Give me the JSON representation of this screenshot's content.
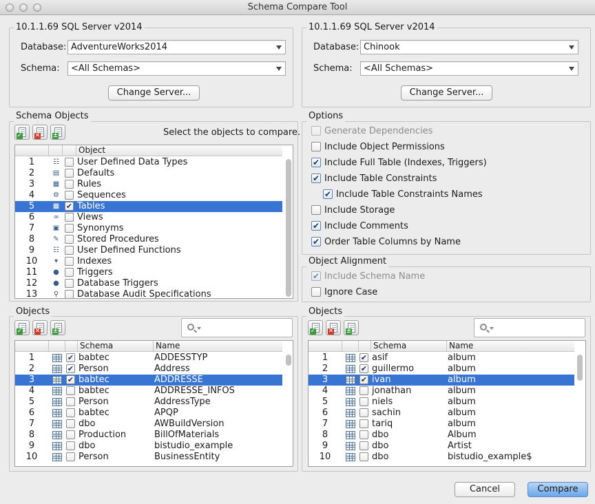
{
  "window": {
    "title": "Schema Compare Tool"
  },
  "left_server": {
    "title": "10.1.1.69 SQL Server v2014",
    "database_label": "Database:",
    "database_value": "AdventureWorks2014",
    "schema_label": "Schema:",
    "schema_value": "<All Schemas>",
    "change_button": "Change Server..."
  },
  "right_server": {
    "title": "10.1.1.69 SQL Server v2014",
    "database_label": "Database:",
    "database_value": "Chinook",
    "schema_label": "Schema:",
    "schema_value": "<All Schemas>",
    "change_button": "Change Server..."
  },
  "schema_objects": {
    "title": "Schema Objects",
    "hint": "Select the objects to compare.",
    "column_object": "Object",
    "rows": [
      {
        "n": "1",
        "label": "User Defined Data Types",
        "checked": false,
        "selected": false,
        "icon": "udt-icon",
        "glyph": "☷"
      },
      {
        "n": "2",
        "label": "Defaults",
        "checked": false,
        "selected": false,
        "icon": "defaults-icon",
        "glyph": "▤"
      },
      {
        "n": "3",
        "label": "Rules",
        "checked": false,
        "selected": false,
        "icon": "rules-icon",
        "glyph": "▦"
      },
      {
        "n": "4",
        "label": "Sequences",
        "checked": false,
        "selected": false,
        "icon": "sequences-icon",
        "glyph": "⚙"
      },
      {
        "n": "5",
        "label": "Tables",
        "checked": true,
        "selected": true,
        "icon": "tables-icon",
        "glyph": "▦"
      },
      {
        "n": "6",
        "label": "Views",
        "checked": false,
        "selected": false,
        "icon": "views-icon",
        "glyph": "∞"
      },
      {
        "n": "7",
        "label": "Synonyms",
        "checked": false,
        "selected": false,
        "icon": "synonyms-icon",
        "glyph": "▣"
      },
      {
        "n": "8",
        "label": "Stored Procedures",
        "checked": false,
        "selected": false,
        "icon": "stored-procedures-icon",
        "glyph": "✎"
      },
      {
        "n": "9",
        "label": "User Defined Functions",
        "checked": false,
        "selected": false,
        "icon": "udf-icon",
        "glyph": "☷"
      },
      {
        "n": "10",
        "label": "Indexes",
        "checked": false,
        "selected": false,
        "icon": "indexes-icon",
        "glyph": "▾"
      },
      {
        "n": "11",
        "label": "Triggers",
        "checked": false,
        "selected": false,
        "icon": "triggers-icon",
        "glyph": "●"
      },
      {
        "n": "12",
        "label": "Database Triggers",
        "checked": false,
        "selected": false,
        "icon": "database-triggers-icon",
        "glyph": "●"
      },
      {
        "n": "13",
        "label": "Database Audit Specifications",
        "checked": false,
        "selected": false,
        "icon": "audit-icon",
        "glyph": "⚲"
      }
    ]
  },
  "options": {
    "title": "Options",
    "items": [
      {
        "label": "Generate Dependencies",
        "checked": false,
        "disabled": true
      },
      {
        "label": "Include Object Permissions",
        "checked": false,
        "disabled": false
      },
      {
        "label": "Include Full Table (Indexes, Triggers)",
        "checked": true,
        "disabled": false
      },
      {
        "label": "Include Table Constraints",
        "checked": true,
        "disabled": false
      },
      {
        "label": "Include Table Constraints Names",
        "checked": true,
        "disabled": false
      },
      {
        "label": "Include Storage",
        "checked": false,
        "disabled": false
      },
      {
        "label": "Include Comments",
        "checked": true,
        "disabled": false
      },
      {
        "label": "Order Table Columns by Name",
        "checked": true,
        "disabled": false
      }
    ]
  },
  "alignment": {
    "title": "Object Alignment",
    "items": [
      {
        "label": "Include Schema Name",
        "checked": true,
        "disabled": true
      },
      {
        "label": "Ignore Case",
        "checked": false,
        "disabled": false
      }
    ]
  },
  "left_objects": {
    "title": "Objects",
    "search_placeholder": "",
    "col_schema": "Schema",
    "col_name": "Name",
    "rows": [
      {
        "n": "1",
        "schema": "babtec",
        "name": "ADDESSTYP",
        "checked": true,
        "selected": false
      },
      {
        "n": "2",
        "schema": "Person",
        "name": "Address",
        "checked": true,
        "selected": false
      },
      {
        "n": "3",
        "schema": "babtec",
        "name": "ADDRESSE",
        "checked": true,
        "selected": true
      },
      {
        "n": "4",
        "schema": "babtec",
        "name": "ADDRESSE_INFOS",
        "checked": false,
        "selected": false
      },
      {
        "n": "5",
        "schema": "Person",
        "name": "AddressType",
        "checked": false,
        "selected": false
      },
      {
        "n": "6",
        "schema": "babtec",
        "name": "APQP",
        "checked": false,
        "selected": false
      },
      {
        "n": "7",
        "schema": "dbo",
        "name": "AWBuildVersion",
        "checked": false,
        "selected": false
      },
      {
        "n": "8",
        "schema": "Production",
        "name": "BillOfMaterials",
        "checked": false,
        "selected": false
      },
      {
        "n": "9",
        "schema": "dbo",
        "name": "bistudio_example",
        "checked": false,
        "selected": false
      },
      {
        "n": "10",
        "schema": "Person",
        "name": "BusinessEntity",
        "checked": false,
        "selected": false
      }
    ]
  },
  "right_objects": {
    "title": "Objects",
    "search_placeholder": "",
    "col_schema": "Schema",
    "col_name": "Name",
    "rows": [
      {
        "n": "1",
        "schema": "asif",
        "name": "album",
        "checked": true,
        "selected": false
      },
      {
        "n": "2",
        "schema": "guillermo",
        "name": "album",
        "checked": true,
        "selected": false
      },
      {
        "n": "3",
        "schema": "ivan",
        "name": "album",
        "checked": true,
        "selected": true
      },
      {
        "n": "4",
        "schema": "jonathan",
        "name": "album",
        "checked": false,
        "selected": false
      },
      {
        "n": "5",
        "schema": "niels",
        "name": "album",
        "checked": false,
        "selected": false
      },
      {
        "n": "6",
        "schema": "sachin",
        "name": "album",
        "checked": false,
        "selected": false
      },
      {
        "n": "7",
        "schema": "tariq",
        "name": "album",
        "checked": false,
        "selected": false
      },
      {
        "n": "8",
        "schema": "dbo",
        "name": "Album",
        "checked": false,
        "selected": false
      },
      {
        "n": "9",
        "schema": "dbo",
        "name": "Artist",
        "checked": false,
        "selected": false
      },
      {
        "n": "10",
        "schema": "dbo",
        "name": "bistudio_example$",
        "checked": false,
        "selected": false
      }
    ]
  },
  "footer": {
    "cancel": "Cancel",
    "compare": "Compare"
  }
}
